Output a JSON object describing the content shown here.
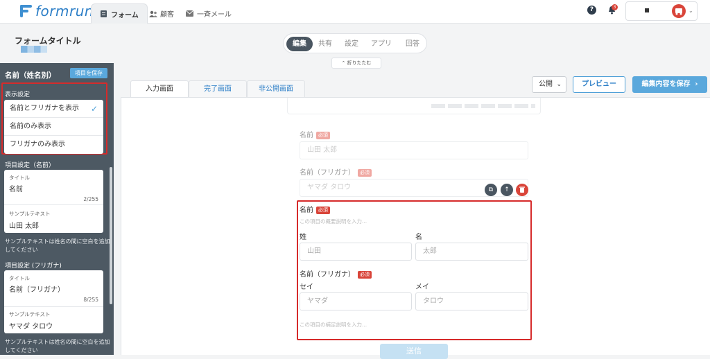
{
  "topbar": {
    "logo": "formrun",
    "nav": [
      {
        "label": "フォーム",
        "icon": "form-icon"
      },
      {
        "label": "顧客",
        "icon": "people-icon"
      },
      {
        "label": "一斉メール",
        "icon": "mail-icon"
      }
    ],
    "help_icon": "?",
    "notification_count": "3"
  },
  "header": {
    "form_title": "フォームタイトル",
    "segments": [
      "編集",
      "共有",
      "設定",
      "アプリ",
      "回答"
    ],
    "active_segment": "編集",
    "fold_label": "折りたたむ"
  },
  "sidebar": {
    "title": "名前（姓名別）",
    "save_item": "項目を保存",
    "display_settings_label": "表示設定",
    "display_options": [
      "名前とフリガナを表示",
      "名前のみ表示",
      "フリガナのみ表示"
    ],
    "selected_option": "名前とフリガナを表示",
    "name_section": {
      "label": "項目設定（名前）",
      "title_label": "タイトル",
      "title_value": "名前",
      "title_count": "2/255",
      "sample_label": "サンプルテキスト",
      "sample_value": "山田 太郎",
      "hint": "サンプルテキストは姓名の間に空白を追加してください"
    },
    "kana_section": {
      "label": "項目設定 (フリガナ)",
      "title_label": "タイトル",
      "title_value": "名前（フリガナ）",
      "title_count": "8/255",
      "sample_label": "サンプルテキスト",
      "sample_value": "ヤマダ タロウ",
      "hint": "サンプルテキストは姓名の間に空白を追加してください"
    }
  },
  "main": {
    "tabs": [
      "入力画面",
      "完了画面",
      "非公開画面"
    ],
    "active_tab": "入力画面",
    "publish_select": "公開",
    "preview_button": "プレビュー",
    "save_button": "編集内容を保存",
    "preview_fields": [
      {
        "label": "名前",
        "required": "必須",
        "placeholder": "山田 太郎"
      },
      {
        "label": "名前（フリガナ）",
        "required": "必須",
        "placeholder": "ヤマダ タロウ"
      }
    ],
    "selected_field": {
      "label": "名前",
      "required": "必須",
      "description_placeholder": "この項目の概要説明を入力...",
      "sei_label": "姓",
      "mei_label": "名",
      "sei_placeholder": "山田",
      "mei_placeholder": "太郎",
      "kana_label": "名前（フリガナ）",
      "kana_required": "必須",
      "kana_sei_label": "セイ",
      "kana_mei_label": "メイ",
      "kana_sei_placeholder": "ヤマダ",
      "kana_mei_placeholder": "タロウ",
      "supplement_placeholder": "この項目の補足説明を入力..."
    },
    "submit_label": "送信"
  },
  "colors": {
    "accent": "#5aa8dc",
    "sidebar": "#4d5963",
    "highlight": "#d62b2b",
    "required": "#d9453a"
  }
}
